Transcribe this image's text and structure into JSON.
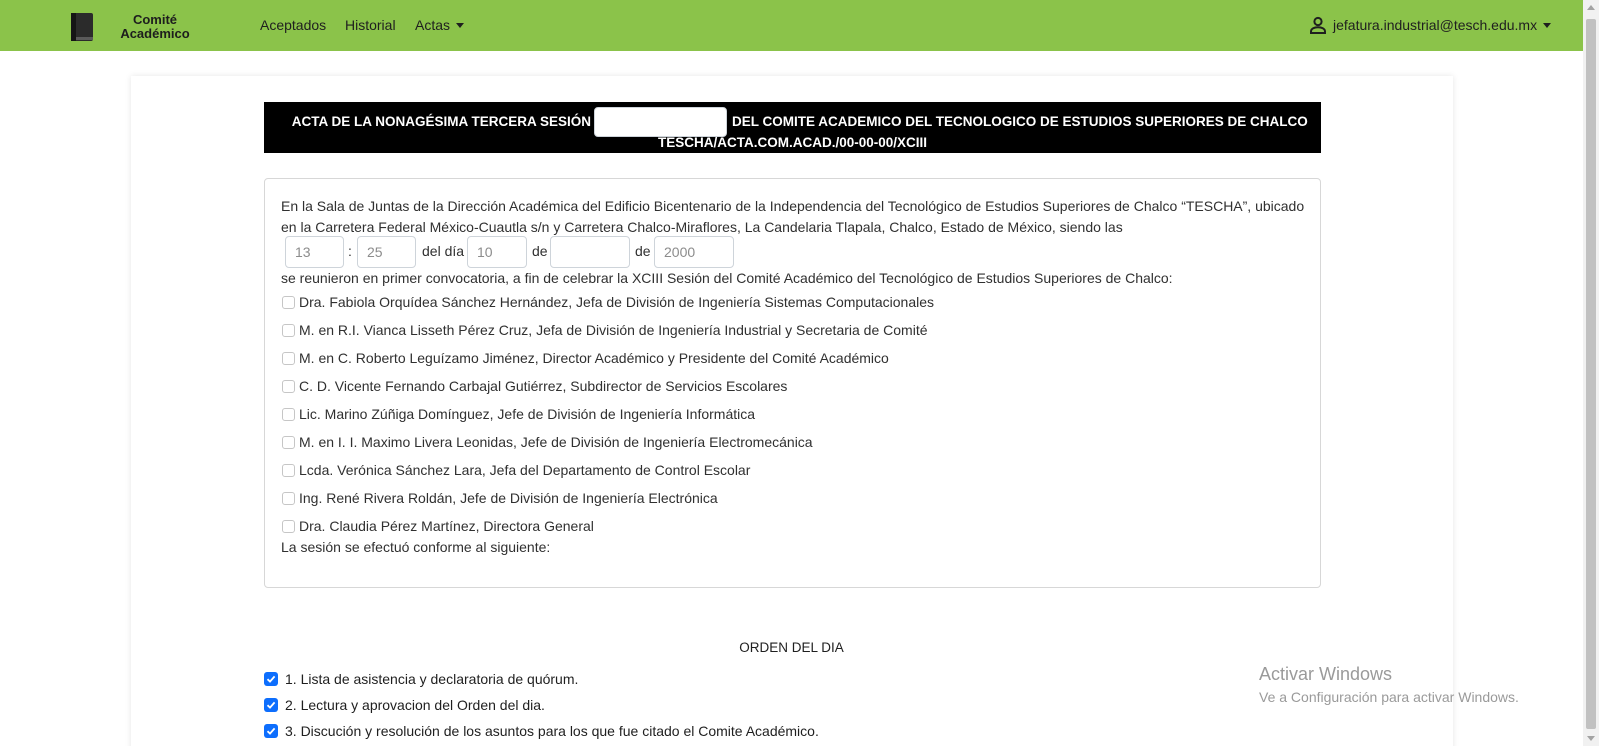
{
  "navbar": {
    "brand_line1": "Comité",
    "brand_line2": "Académico",
    "links": {
      "aceptados": "Aceptados",
      "historial": "Historial",
      "actas": "Actas"
    },
    "user_email": "jefatura.industrial@tesch.edu.mx",
    "background_color": "#8bc34a",
    "brand_icon": "book-icon",
    "user_icon": "person-icon"
  },
  "acta": {
    "title_part1": "ACTA DE LA NONAGÉSIMA TERCERA SESIÓN",
    "session_type_value": "",
    "title_part2": "DEL COMITE ACADEMICO DEL TECNOLOGICO DE ESTUDIOS SUPERIORES DE CHALCO",
    "code": "TESCHA/ACTA.COM.ACAD./00-00-00/XCIII",
    "intro": "En la Sala de Juntas de la Dirección Académica del Edificio Bicentenario de la Independencia del Tecnológico de Estudios Superiores de Chalco “TESCHA”, ubicado en la Carretera Federal México-Cuautla s/n y Carretera Chalco-Miraflores, La Candelaria Tlapala, Chalco, Estado de México, siendo las",
    "time": {
      "hour_placeholder": "13",
      "separator": ":",
      "minute_placeholder": "25",
      "del_dia_label": "del día",
      "day_placeholder": "10",
      "de_label": "de",
      "month_value": "",
      "de_label2": "de",
      "year_placeholder": "2000"
    },
    "convocatoria": "se reunieron en primer convocatoria, a fin de celebrar la XCIII Sesión del Comité Académico del Tecnológico de Estudios Superiores de Chalco:",
    "attendees": [
      {
        "label": "Dra. Fabiola Orquídea Sánchez Hernández, Jefa de División de Ingeniería Sistemas Computacionales",
        "checked": false
      },
      {
        "label": "M. en R.I. Vianca Lisseth Pérez Cruz, Jefa de División de Ingeniería Industrial y Secretaria de Comité",
        "checked": false
      },
      {
        "label": "M. en C. Roberto Leguízamo Jiménez, Director Académico y Presidente del Comité Académico",
        "checked": false
      },
      {
        "label": "C. D. Vicente Fernando Carbajal Gutiérrez, Subdirector de Servicios Escolares",
        "checked": false
      },
      {
        "label": "Lic. Marino Zúñiga Domínguez, Jefe de División de Ingeniería Informática",
        "checked": false
      },
      {
        "label": "M. en I. I. Maximo Livera Leonidas, Jefe de División de Ingeniería Electromecánica",
        "checked": false
      },
      {
        "label": "Lcda. Verónica Sánchez Lara, Jefa del Departamento de Control Escolar",
        "checked": false
      },
      {
        "label": "Ing. René Rivera Roldán, Jefe de División de Ingeniería Electrónica",
        "checked": false
      },
      {
        "label": "Dra. Claudia Pérez Martínez, Directora General",
        "checked": false
      }
    ],
    "closing": "La sesión se efectuó conforme al siguiente:"
  },
  "orden": {
    "title": "ORDEN DEL DIA",
    "items": [
      {
        "label": "1. Lista de asistencia y declaratoria de quórum.",
        "checked": true
      },
      {
        "label": "2. Lectura y aprovacion del Orden del dia.",
        "checked": true
      },
      {
        "label": "3. Discución y resolución de los asuntos para los que fue citado el Comite Académico.",
        "checked": true
      }
    ],
    "checkbox_color": "#0d6efd"
  },
  "watermark": {
    "title": "Activar Windows",
    "subtitle": "Ve a Configuración para activar Windows."
  }
}
